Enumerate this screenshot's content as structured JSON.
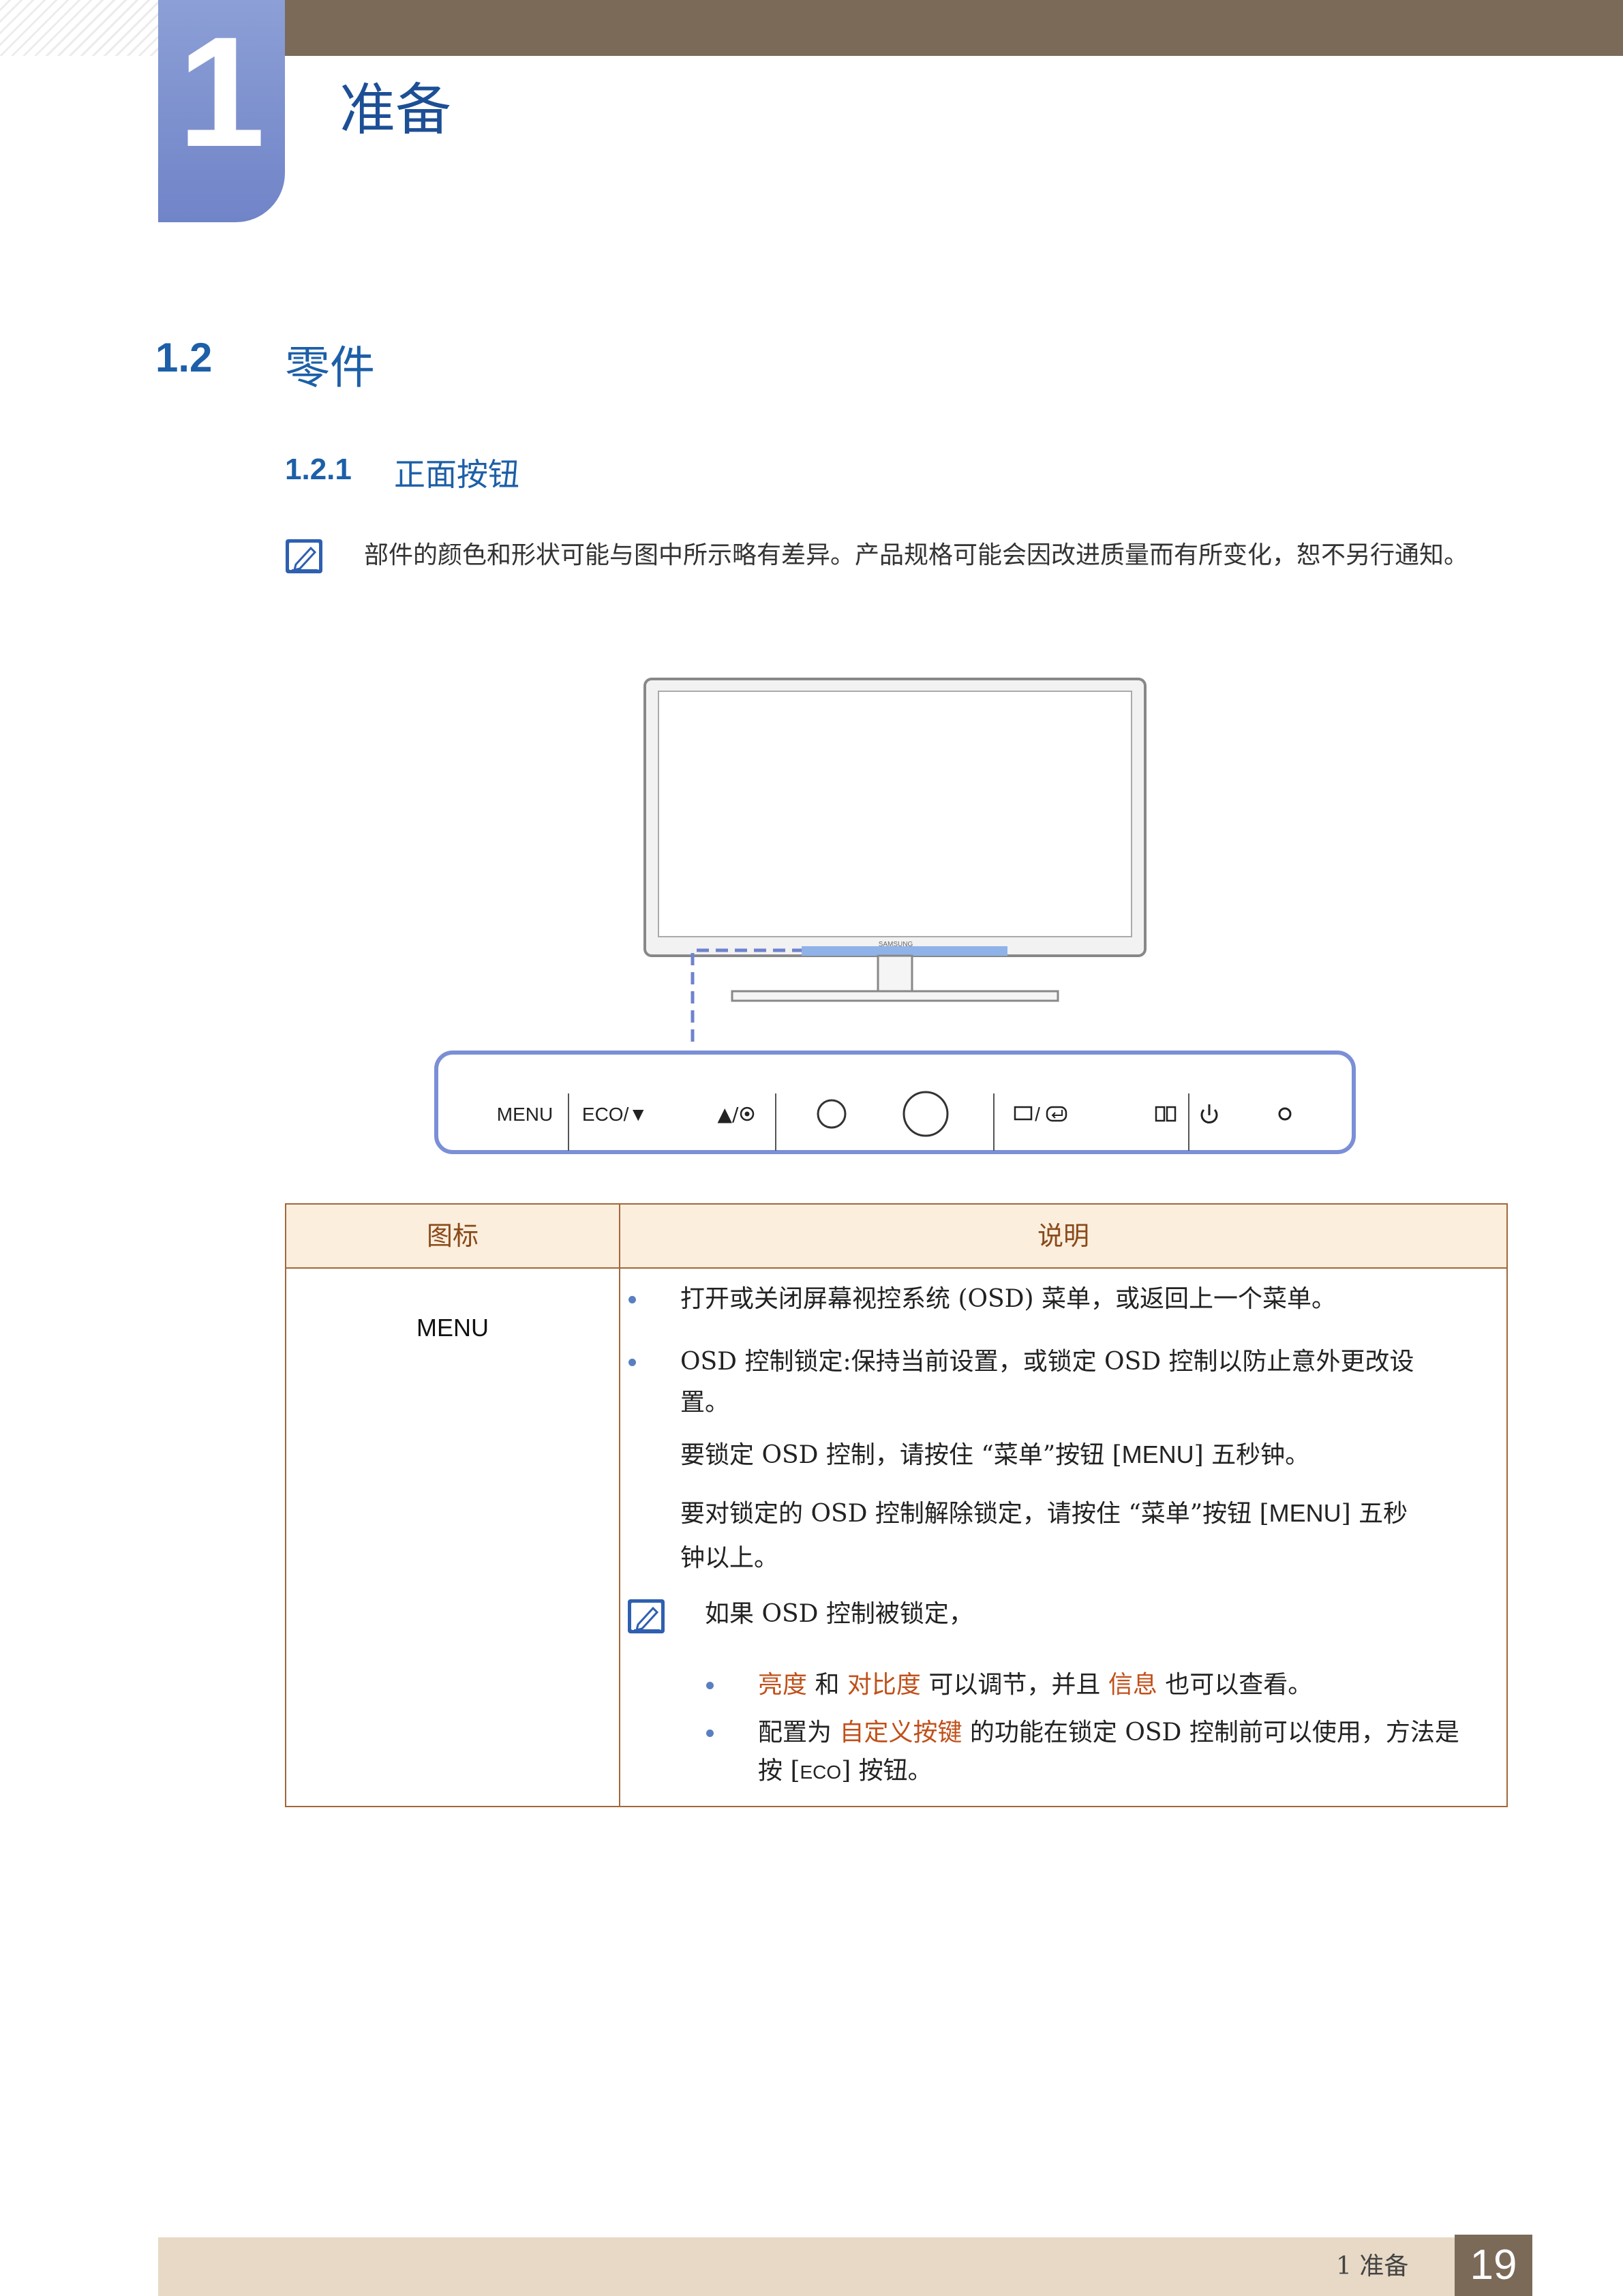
{
  "header": {
    "chapter_number": "1",
    "chapter_title": "准备"
  },
  "section": {
    "number": "1.2",
    "title": "零件",
    "subsection_number": "1.2.1",
    "subsection_title": "正面按钮"
  },
  "note": {
    "icon": "note-pencil-icon",
    "text": "部件的颜色和形状可能与图中所示略有差异。产品规格可能会因改进质量而有所变化，恕不另行通知。"
  },
  "diagram": {
    "brand_label": "SAMSUNG",
    "buttons": [
      {
        "label": "MENU"
      },
      {
        "label": "ECO/▼"
      },
      {
        "label": "▲/◉"
      },
      {
        "label": "circle-button-small"
      },
      {
        "label": "circle-button-large"
      },
      {
        "label": "▭/⏎"
      },
      {
        "label": "▯▯"
      },
      {
        "label": "power-icon"
      },
      {
        "label": "led-indicator"
      }
    ],
    "labels": {
      "menu": "MENU",
      "eco": "ECO/▼",
      "up": "▲/",
      "source": "/"
    }
  },
  "table": {
    "header_icon": "图标",
    "header_description": "说明",
    "row_icon_label": "MENU",
    "bullet1": "打开或关闭屏幕视控系统 (OSD) 菜单，或返回上一个菜单。",
    "bullet2_line1": "OSD 控制锁定:保持当前设置，或锁定 OSD 控制以防止意外更改设",
    "bullet2_line2": "置。",
    "para1_a": "要锁定 OSD 控制，请按住 “菜单”按钮 [",
    "para1_key": "MENU",
    "para1_b": "] 五秒钟。",
    "para2_a": "要对锁定的 OSD 控制解除锁定，请按住 “菜单”按钮 [",
    "para2_key": "MENU",
    "para2_b": "] 五秒",
    "para2_line2": "钟以上。",
    "note_intro": "如果 OSD 控制被锁定，",
    "sub1_hl1": "亮度",
    "sub1_mid1": " 和 ",
    "sub1_hl2": "对比度",
    "sub1_mid2": " 可以调节，并且 ",
    "sub1_hl3": "信息",
    "sub1_end": " 也可以查看。",
    "sub2_a": "配置为 ",
    "sub2_hl": "自定义按键",
    "sub2_b": " 的功能在锁定 OSD 控制前可以使用，方法是",
    "sub2_line2_a": "按 [",
    "sub2_key": "ECO",
    "sub2_line2_b": "] 按钮。"
  },
  "footer": {
    "chapter": "1 准备",
    "page_number": "19"
  },
  "colors": {
    "accent_blue": "#1d5fa8",
    "chapter_block": "#7084c8",
    "bar_brown": "#7b6a58",
    "table_border": "#a0683a",
    "highlight": "#c0501a"
  }
}
